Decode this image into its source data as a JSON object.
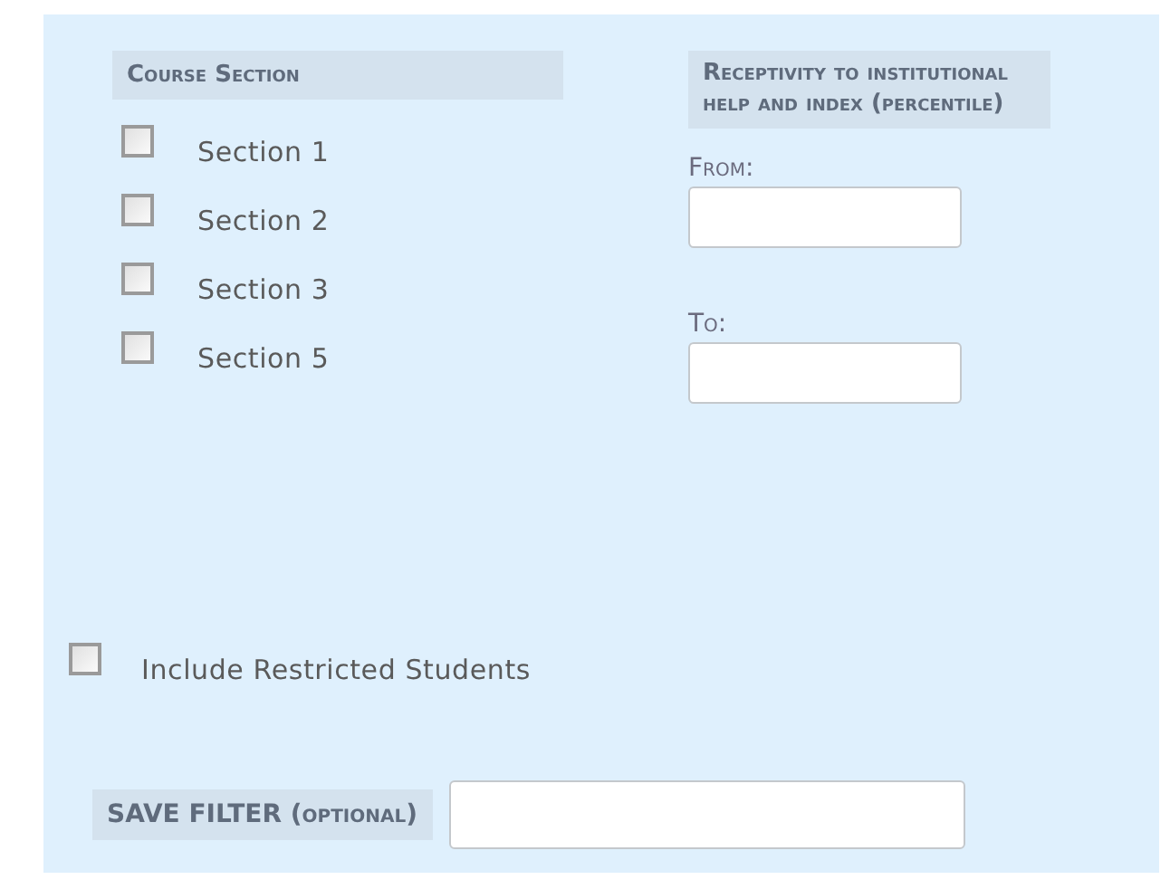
{
  "course_section": {
    "heading": "Course Section",
    "options": [
      {
        "label": "Section 1",
        "checked": false
      },
      {
        "label": "Section 2",
        "checked": false
      },
      {
        "label": "Section 3",
        "checked": false
      },
      {
        "label": "Section 5",
        "checked": false
      }
    ]
  },
  "receptivity": {
    "heading": "Receptivity to institutional help and index (percentile)",
    "from_label": "From:",
    "to_label": "To:"
  },
  "include_restricted": {
    "label": "Include Restricted Students",
    "checked": false
  },
  "save_filter": {
    "label": "SAVE FILTER (optional)"
  }
}
